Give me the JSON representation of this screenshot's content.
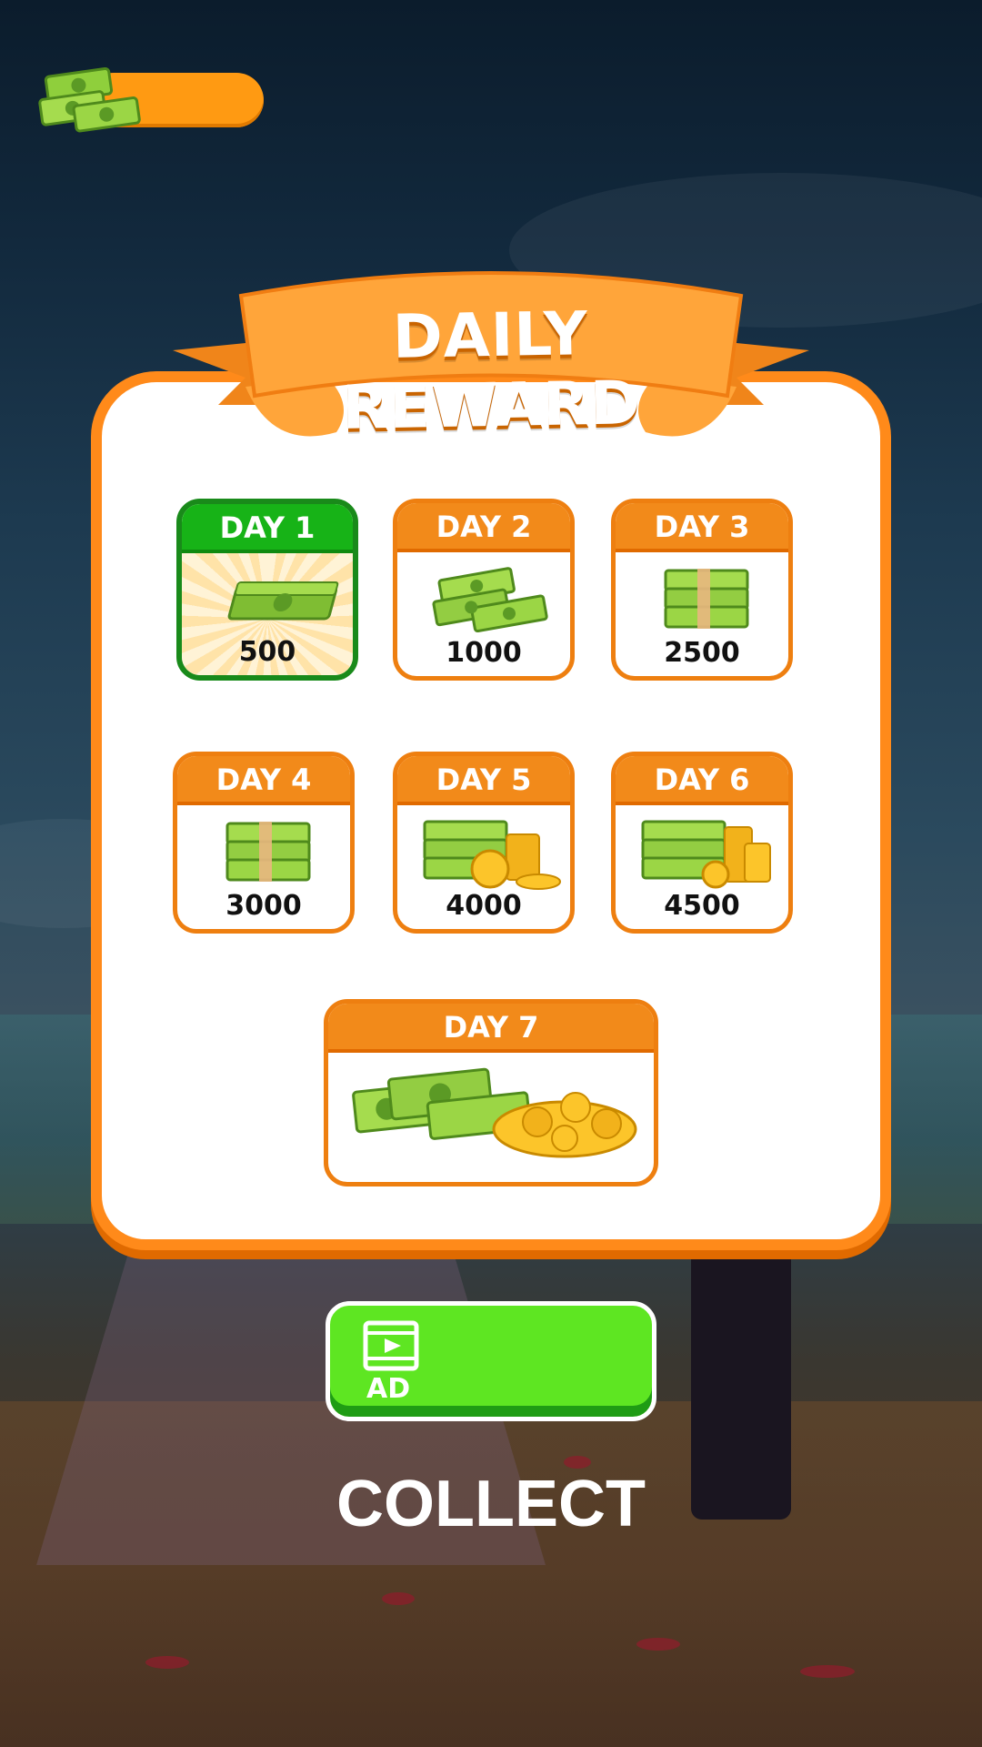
{
  "header": {
    "coin_icon": "cash-stack-icon",
    "coin_value": ""
  },
  "panel": {
    "title": "DAILY REWARD"
  },
  "days": [
    {
      "label": "DAY 1",
      "amount": "500",
      "state": "claimed",
      "icon": "cash-bundle-icon"
    },
    {
      "label": "DAY 2",
      "amount": "1000",
      "state": "locked",
      "icon": "cash-pile-icon"
    },
    {
      "label": "DAY 3",
      "amount": "2500",
      "state": "locked",
      "icon": "cash-stack-icon"
    },
    {
      "label": "DAY 4",
      "amount": "3000",
      "state": "locked",
      "icon": "cash-stack-icon"
    },
    {
      "label": "DAY 5",
      "amount": "4000",
      "state": "locked",
      "icon": "cash-and-coins-icon"
    },
    {
      "label": "DAY 6",
      "amount": "4500",
      "state": "locked",
      "icon": "cash-and-coins-icon"
    },
    {
      "label": "DAY 7",
      "amount": "",
      "state": "locked",
      "icon": "cash-and-coin-pile-icon"
    }
  ],
  "ad_button": {
    "label": "AD",
    "icon": "video-play-icon"
  },
  "collect": {
    "label": "COLLECT"
  },
  "colors": {
    "orange": "#f28a1a",
    "green_claimed": "#17b317",
    "ad_green": "#5ee622"
  }
}
